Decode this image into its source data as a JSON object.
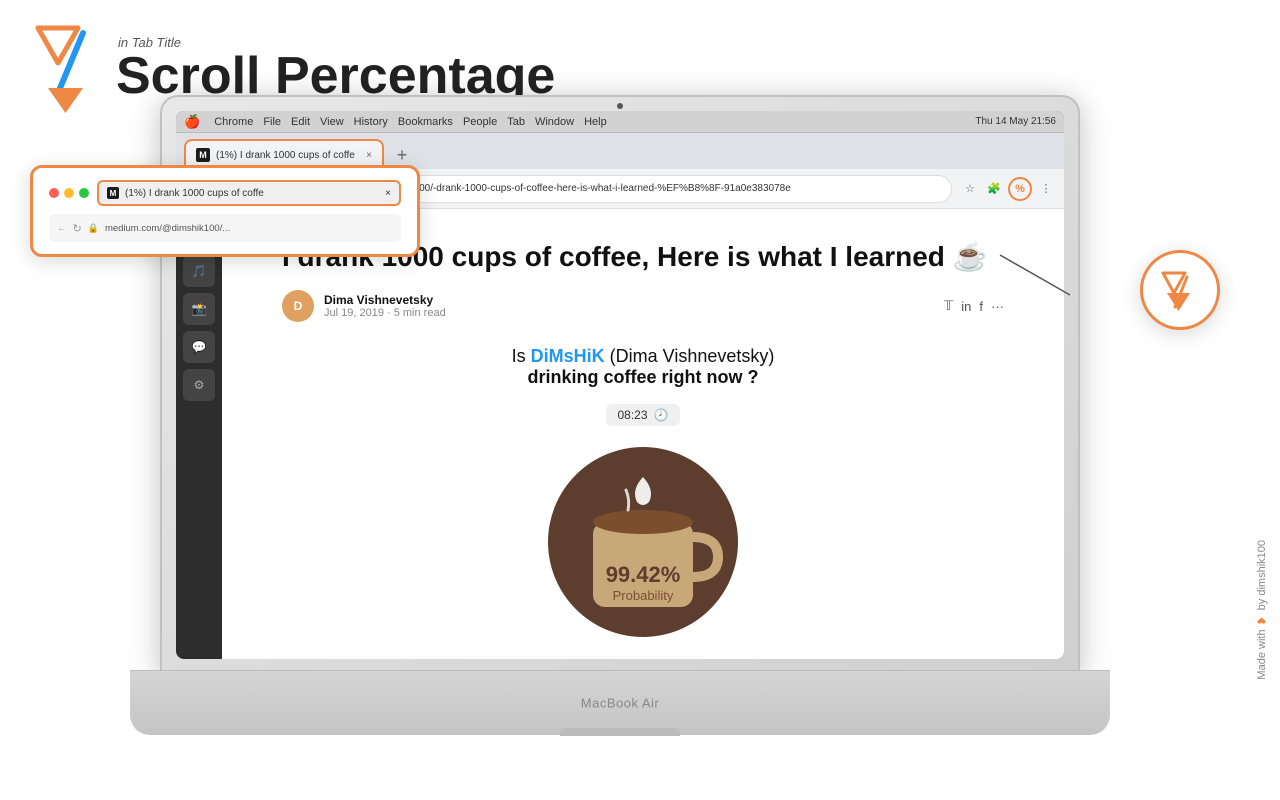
{
  "logo": {
    "subtitle": "in Tab Title",
    "title": "Scroll Percentage"
  },
  "laptop": {
    "model": "MacBook Air"
  },
  "macos": {
    "menubar": {
      "apple": "🍎",
      "items": [
        "Chrome",
        "File",
        "Edit",
        "View",
        "History",
        "Bookmarks",
        "People",
        "Tab",
        "Window",
        "Help"
      ],
      "rightItems": "Thu 14 May  21:56"
    }
  },
  "browser": {
    "tab": {
      "label": "(1%) I drank 1000 cups of coffe",
      "url": "medium.com/@dimshik100/-drank-1000-cups-of-coffee-here-is-what-i-learned-%EF%B8%8F-91a0e383078e",
      "full_url": "medium.com/@dimshik100/-drank-1000-cups-of-coffee-here-is-what-i-learned-%EF%B8%8F-91a0e383078e"
    }
  },
  "article": {
    "title": "I drank 1000 cups of coffee, Here is what I learned ☕",
    "author": "Dima Vishnevetsky",
    "date": "Jul 19, 2019 · 5 min read",
    "cta_prefix": "Is ",
    "cta_highlight": "DiMsHiK",
    "cta_author": "(Dima Vishnevetsky)",
    "cta_suffix": "drinking coffee right now ?",
    "time": "08:23",
    "probability": "99.42%",
    "probability_label": "Probability"
  },
  "callout": {
    "tab_label": "(1%) I drank 1000 cups of coffe",
    "tab_close": "×",
    "address": "medium.com/@dimshik100/..."
  },
  "extension": {
    "symbol": "%"
  },
  "footer": {
    "made_with": "Made with ❤ by dimshik100"
  }
}
